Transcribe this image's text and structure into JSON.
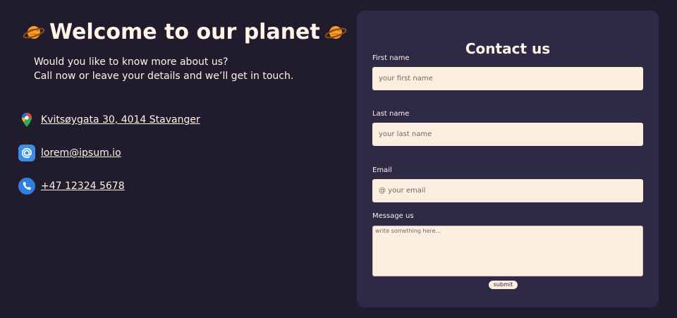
{
  "header": {
    "title": "Welcome to our planet",
    "intro_line1": "Would you like to know more about us?",
    "intro_line2": "Call now or leave your details and we’ll get in touch."
  },
  "contacts": {
    "address": "Kvitsøygata 30, 4014 Stavanger",
    "email": "lorem@ipsum.io",
    "phone": "+47 12324 5678"
  },
  "form": {
    "title": "Contact us",
    "first_name_label": "First name",
    "first_name_placeholder": "your first name",
    "last_name_label": "Last name",
    "last_name_placeholder": "your last name",
    "email_label": "Email",
    "email_placeholder": "@ your email",
    "message_label": "Message us",
    "message_placeholder": "write something here...",
    "submit_label": "submit"
  },
  "icons": {
    "title_left": "planet-icon",
    "title_right": "planet-icon",
    "address": "map-pin-icon",
    "email": "at-sign-icon",
    "phone": "phone-icon"
  },
  "colors": {
    "background": "#211b2e",
    "card": "#2e2945",
    "text": "#fff4e6",
    "input": "#fdeedf",
    "email_icon": "#3a8ee6",
    "phone_icon": "#2f7fe0"
  }
}
